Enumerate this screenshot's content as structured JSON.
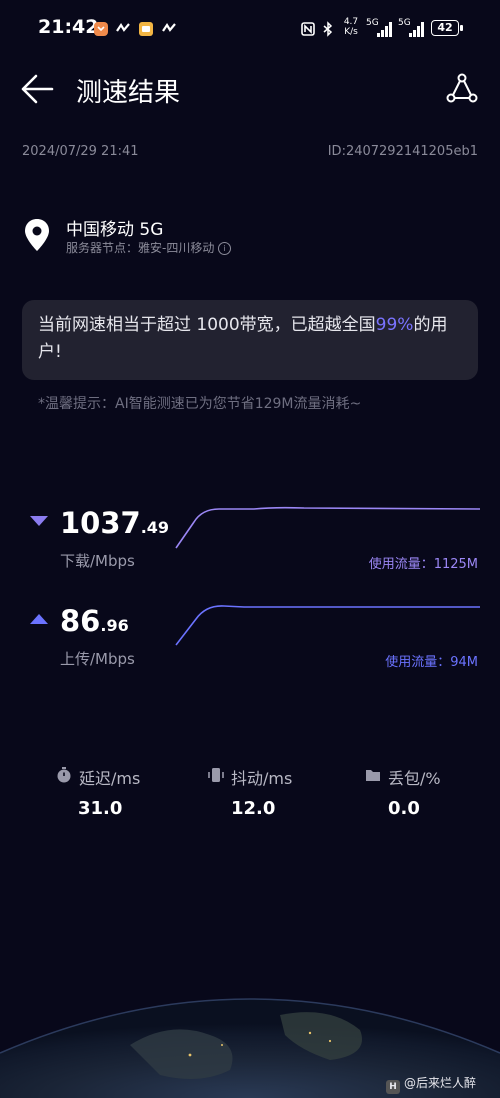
{
  "status_bar": {
    "time": "21:42",
    "net_speed": "4.7 K/s",
    "sig1": "5G",
    "sig2": "5G",
    "battery": "42"
  },
  "header": {
    "title": "测速结果"
  },
  "meta": {
    "datetime": "2024/07/29 21:41",
    "id": "ID:2407292141205eb1"
  },
  "operator": {
    "name": "中国移动 5G",
    "node": "服务器节点：雅安-四川移动"
  },
  "card": {
    "text_before": "当前网速相当于超过 1000带宽，已超越全国",
    "highlight": "99%",
    "text_after": "的用户!"
  },
  "tip": "*温馨提示：AI智能测速已为您节省129M流量消耗~",
  "download": {
    "value_int": "1037",
    "value_dec": ".49",
    "unit": "下载/Mbps",
    "usage": "使用流量：1125M",
    "color": "#9b87f5"
  },
  "upload": {
    "value_int": "86",
    "value_dec": ".96",
    "unit": "上传/Mbps",
    "usage": "使用流量：94M",
    "color": "#6b73ff"
  },
  "stats": {
    "latency_label": "延迟/ms",
    "latency_value": "31.0",
    "jitter_label": "抖动/ms",
    "jitter_value": "12.0",
    "loss_label": "丢包/%",
    "loss_value": "0.0"
  },
  "watermark": "@后来烂人醉"
}
